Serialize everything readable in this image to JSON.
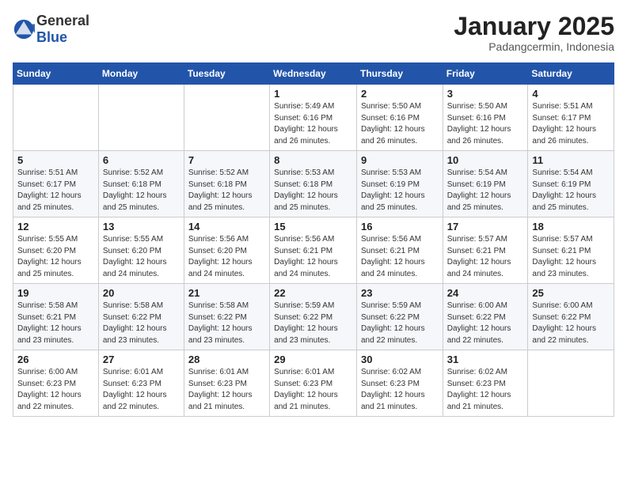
{
  "header": {
    "logo_general": "General",
    "logo_blue": "Blue",
    "month": "January 2025",
    "location": "Padangcermin, Indonesia"
  },
  "weekdays": [
    "Sunday",
    "Monday",
    "Tuesday",
    "Wednesday",
    "Thursday",
    "Friday",
    "Saturday"
  ],
  "weeks": [
    [
      {
        "day": "",
        "info": ""
      },
      {
        "day": "",
        "info": ""
      },
      {
        "day": "",
        "info": ""
      },
      {
        "day": "1",
        "info": "Sunrise: 5:49 AM\nSunset: 6:16 PM\nDaylight: 12 hours\nand 26 minutes."
      },
      {
        "day": "2",
        "info": "Sunrise: 5:50 AM\nSunset: 6:16 PM\nDaylight: 12 hours\nand 26 minutes."
      },
      {
        "day": "3",
        "info": "Sunrise: 5:50 AM\nSunset: 6:16 PM\nDaylight: 12 hours\nand 26 minutes."
      },
      {
        "day": "4",
        "info": "Sunrise: 5:51 AM\nSunset: 6:17 PM\nDaylight: 12 hours\nand 26 minutes."
      }
    ],
    [
      {
        "day": "5",
        "info": "Sunrise: 5:51 AM\nSunset: 6:17 PM\nDaylight: 12 hours\nand 25 minutes."
      },
      {
        "day": "6",
        "info": "Sunrise: 5:52 AM\nSunset: 6:18 PM\nDaylight: 12 hours\nand 25 minutes."
      },
      {
        "day": "7",
        "info": "Sunrise: 5:52 AM\nSunset: 6:18 PM\nDaylight: 12 hours\nand 25 minutes."
      },
      {
        "day": "8",
        "info": "Sunrise: 5:53 AM\nSunset: 6:18 PM\nDaylight: 12 hours\nand 25 minutes."
      },
      {
        "day": "9",
        "info": "Sunrise: 5:53 AM\nSunset: 6:19 PM\nDaylight: 12 hours\nand 25 minutes."
      },
      {
        "day": "10",
        "info": "Sunrise: 5:54 AM\nSunset: 6:19 PM\nDaylight: 12 hours\nand 25 minutes."
      },
      {
        "day": "11",
        "info": "Sunrise: 5:54 AM\nSunset: 6:19 PM\nDaylight: 12 hours\nand 25 minutes."
      }
    ],
    [
      {
        "day": "12",
        "info": "Sunrise: 5:55 AM\nSunset: 6:20 PM\nDaylight: 12 hours\nand 25 minutes."
      },
      {
        "day": "13",
        "info": "Sunrise: 5:55 AM\nSunset: 6:20 PM\nDaylight: 12 hours\nand 24 minutes."
      },
      {
        "day": "14",
        "info": "Sunrise: 5:56 AM\nSunset: 6:20 PM\nDaylight: 12 hours\nand 24 minutes."
      },
      {
        "day": "15",
        "info": "Sunrise: 5:56 AM\nSunset: 6:21 PM\nDaylight: 12 hours\nand 24 minutes."
      },
      {
        "day": "16",
        "info": "Sunrise: 5:56 AM\nSunset: 6:21 PM\nDaylight: 12 hours\nand 24 minutes."
      },
      {
        "day": "17",
        "info": "Sunrise: 5:57 AM\nSunset: 6:21 PM\nDaylight: 12 hours\nand 24 minutes."
      },
      {
        "day": "18",
        "info": "Sunrise: 5:57 AM\nSunset: 6:21 PM\nDaylight: 12 hours\nand 23 minutes."
      }
    ],
    [
      {
        "day": "19",
        "info": "Sunrise: 5:58 AM\nSunset: 6:21 PM\nDaylight: 12 hours\nand 23 minutes."
      },
      {
        "day": "20",
        "info": "Sunrise: 5:58 AM\nSunset: 6:22 PM\nDaylight: 12 hours\nand 23 minutes."
      },
      {
        "day": "21",
        "info": "Sunrise: 5:58 AM\nSunset: 6:22 PM\nDaylight: 12 hours\nand 23 minutes."
      },
      {
        "day": "22",
        "info": "Sunrise: 5:59 AM\nSunset: 6:22 PM\nDaylight: 12 hours\nand 23 minutes."
      },
      {
        "day": "23",
        "info": "Sunrise: 5:59 AM\nSunset: 6:22 PM\nDaylight: 12 hours\nand 22 minutes."
      },
      {
        "day": "24",
        "info": "Sunrise: 6:00 AM\nSunset: 6:22 PM\nDaylight: 12 hours\nand 22 minutes."
      },
      {
        "day": "25",
        "info": "Sunrise: 6:00 AM\nSunset: 6:22 PM\nDaylight: 12 hours\nand 22 minutes."
      }
    ],
    [
      {
        "day": "26",
        "info": "Sunrise: 6:00 AM\nSunset: 6:23 PM\nDaylight: 12 hours\nand 22 minutes."
      },
      {
        "day": "27",
        "info": "Sunrise: 6:01 AM\nSunset: 6:23 PM\nDaylight: 12 hours\nand 22 minutes."
      },
      {
        "day": "28",
        "info": "Sunrise: 6:01 AM\nSunset: 6:23 PM\nDaylight: 12 hours\nand 21 minutes."
      },
      {
        "day": "29",
        "info": "Sunrise: 6:01 AM\nSunset: 6:23 PM\nDaylight: 12 hours\nand 21 minutes."
      },
      {
        "day": "30",
        "info": "Sunrise: 6:02 AM\nSunset: 6:23 PM\nDaylight: 12 hours\nand 21 minutes."
      },
      {
        "day": "31",
        "info": "Sunrise: 6:02 AM\nSunset: 6:23 PM\nDaylight: 12 hours\nand 21 minutes."
      },
      {
        "day": "",
        "info": ""
      }
    ]
  ]
}
